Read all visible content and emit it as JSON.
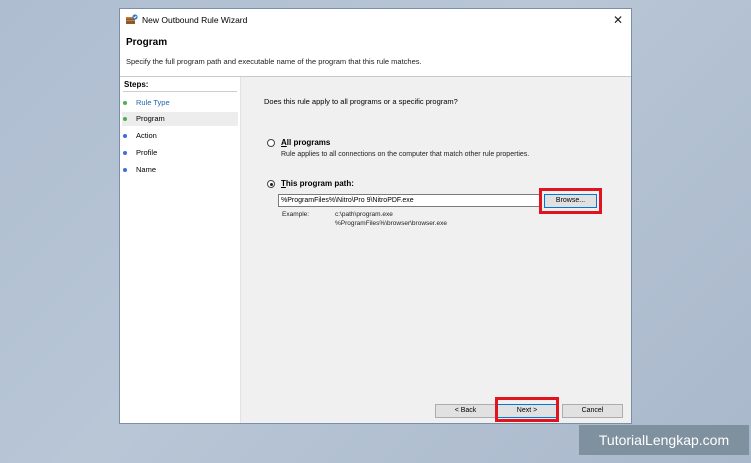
{
  "window": {
    "title": "New Outbound Rule Wizard",
    "close_glyph": "✕",
    "icon": "firewall-rule-icon"
  },
  "header": {
    "heading": "Program",
    "description": "Specify the full program path and executable name of the program that this rule matches."
  },
  "steps": {
    "title": "Steps:",
    "items": [
      {
        "label": "Rule Type",
        "state": "done"
      },
      {
        "label": "Program",
        "state": "current"
      },
      {
        "label": "Action",
        "state": "todo"
      },
      {
        "label": "Profile",
        "state": "todo"
      },
      {
        "label": "Name",
        "state": "todo"
      }
    ]
  },
  "content": {
    "question": "Does this rule apply to all programs or a specific program?",
    "all_programs": {
      "label_accel": "A",
      "label_rest": "ll programs",
      "description": "Rule applies to all connections on the computer that match other rule properties.",
      "selected": false
    },
    "this_program": {
      "label_accel": "T",
      "label_rest": "his program path:",
      "selected": true
    },
    "path_value": "%ProgramFiles%\\Nitro\\Pro 9\\NitroPDF.exe",
    "browse_label": "Browse...",
    "example_label": "Example:",
    "example_lines": [
      "c:\\path\\program.exe",
      "%ProgramFiles%\\browser\\browser.exe"
    ]
  },
  "footer": {
    "back_label": "< Back",
    "next_label": "Next >",
    "cancel_label": "Cancel"
  },
  "watermark": "TutorialLengkap.com",
  "colors": {
    "highlight": "#e0141e",
    "step_done_text": "#1e64b4",
    "step_done_dot": "#4caf50",
    "step_todo_dot": "#3f6fd6",
    "content_bg": "#f0f0f0"
  }
}
